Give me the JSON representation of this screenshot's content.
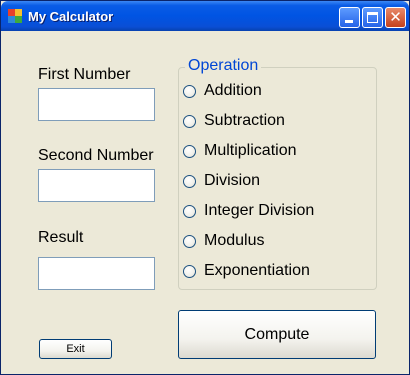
{
  "window": {
    "title": "My Calculator",
    "icons": {
      "app": "calculator-app-icon",
      "minimize": "minimize-icon",
      "maximize": "maximize-icon",
      "close": "close-icon"
    },
    "close_glyph": "✕"
  },
  "form": {
    "first_label": "First Number",
    "first_value": "",
    "second_label": "Second Number",
    "second_value": "",
    "result_label": "Result",
    "result_value": ""
  },
  "operation": {
    "title": "Operation",
    "options": [
      "Addition",
      "Subtraction",
      "Multiplication",
      "Division",
      "Integer Division",
      "Modulus",
      "Exponentiation"
    ]
  },
  "buttons": {
    "exit": "Exit",
    "compute": "Compute"
  },
  "colors": {
    "titlebar": "#0054e3",
    "face": "#ece9d8",
    "group_title": "#0046d5"
  }
}
